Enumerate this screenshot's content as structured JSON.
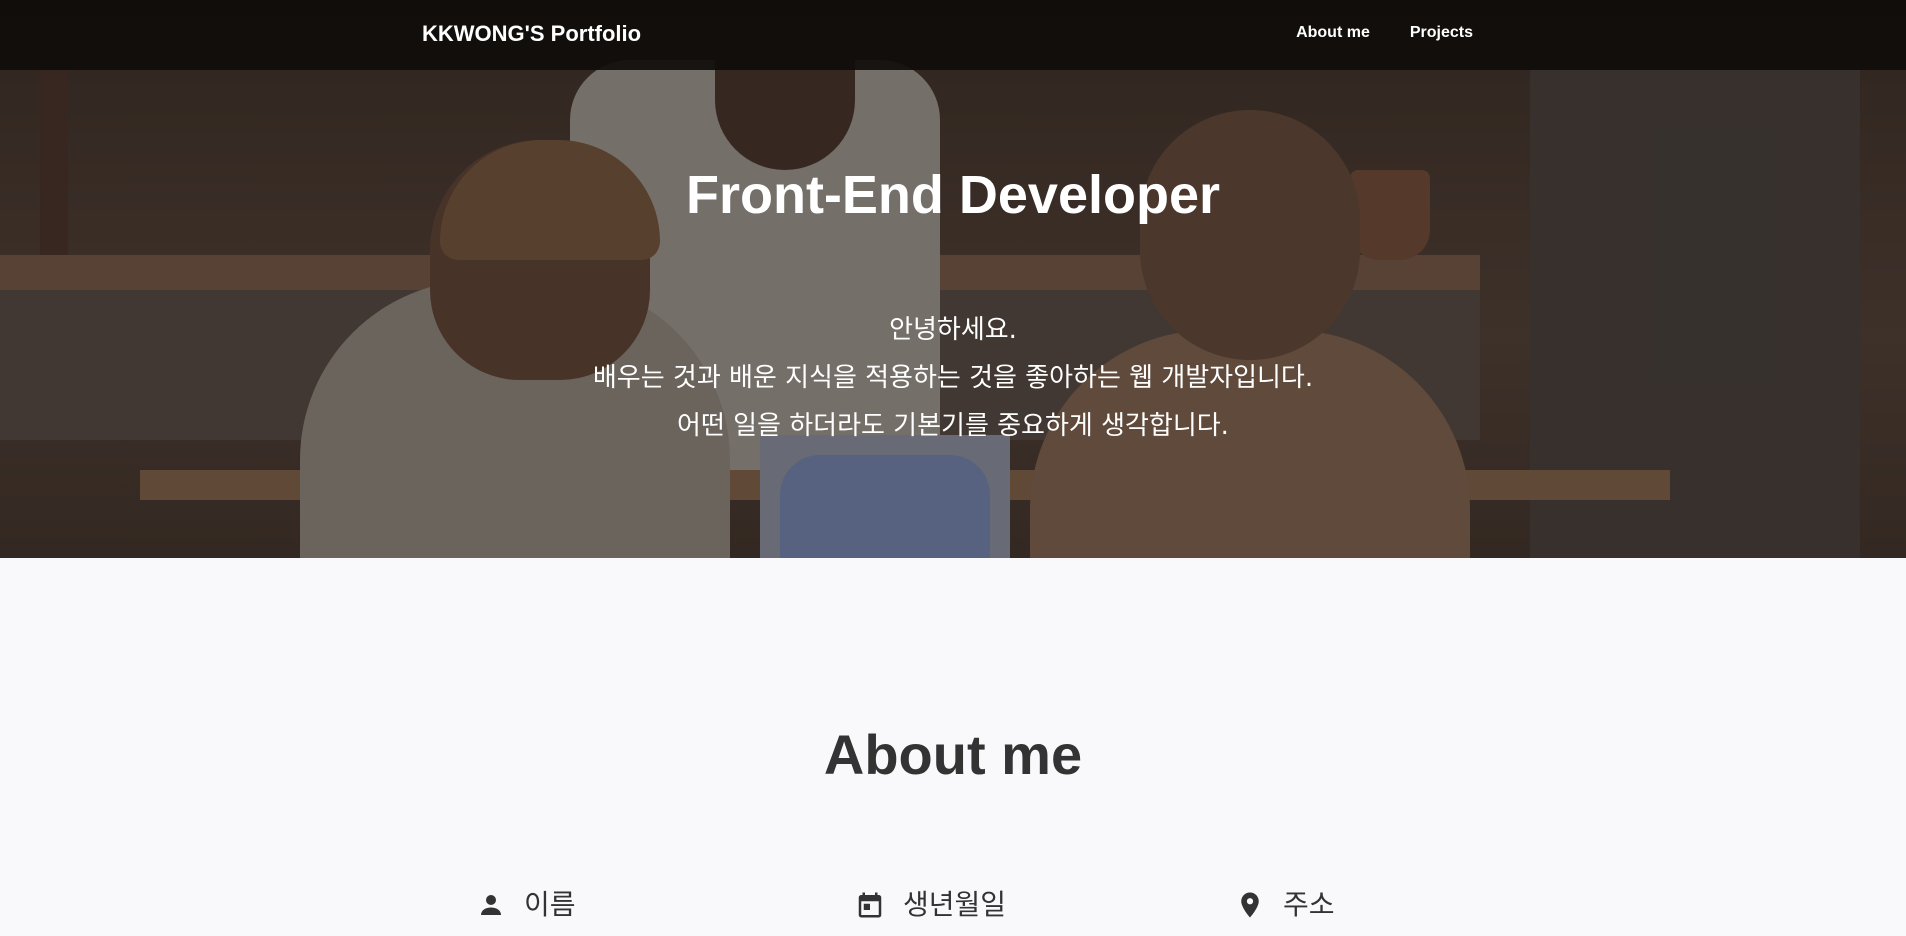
{
  "nav": {
    "brand": "KKWONG'S Portfolio",
    "links": [
      "About me",
      "Projects"
    ]
  },
  "hero": {
    "title": "Front-End Developer",
    "lines": [
      "안녕하세요.",
      "배우는 것과 배운 지식을 적용하는 것을 좋아하는 웹 개발자입니다.",
      "어떤 일을 하더라도 기본기를 중요하게 생각합니다."
    ]
  },
  "about": {
    "title": "About me",
    "items": [
      {
        "icon": "person-icon",
        "label": "이름"
      },
      {
        "icon": "calendar-icon",
        "label": "생년월일"
      },
      {
        "icon": "location-pin-icon",
        "label": "주소"
      }
    ]
  },
  "colors": {
    "navbar": "#0f0c0a",
    "text_dark": "#333333",
    "page_bg": "#f9f9fb"
  }
}
